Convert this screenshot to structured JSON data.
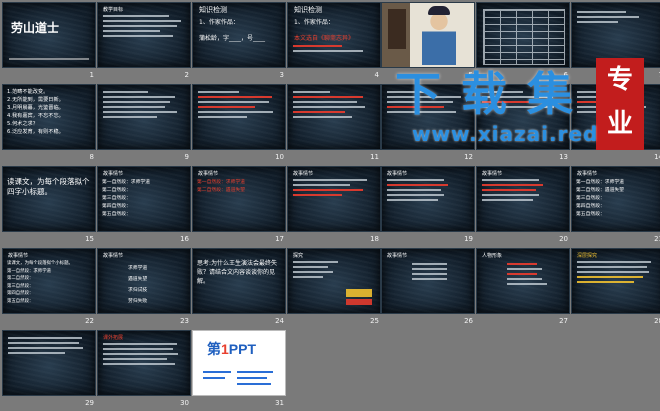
{
  "slides": [
    {
      "num": "1",
      "title": "劳山道士"
    },
    {
      "num": "2",
      "heading": "教学目标"
    },
    {
      "num": "3",
      "heading": "知识检测",
      "line1": "1、作家作品：",
      "line2": "蒲松龄，字____，号____"
    },
    {
      "num": "4",
      "heading": "知识检测",
      "line1": "1、作家作品：",
      "line2": "本文选自《聊斋志异》"
    },
    {
      "num": "5"
    },
    {
      "num": "6"
    },
    {
      "num": "7"
    },
    {
      "num": "8",
      "lines": [
        "1.范畴不能改变。",
        "2.无所能到，需要日新。",
        "3.月明晨暮，光鉴晋临。",
        "4.我有嘉宾，不忘不忘。",
        "5.何术之求？",
        "6.泛应发育，有则不稳。"
      ]
    },
    {
      "num": "9"
    },
    {
      "num": "10"
    },
    {
      "num": "11"
    },
    {
      "num": "12"
    },
    {
      "num": "13"
    },
    {
      "num": "14"
    },
    {
      "num": "15",
      "text": "读课文，为每个段落拟个四字小标题。"
    },
    {
      "num": "16",
      "heading": "故事情节",
      "lines": [
        "第一自然段：求师学道",
        "第二自然段：",
        "第三自然段：",
        "第四自然段：",
        "第五自然段："
      ]
    },
    {
      "num": "17",
      "heading": "故事情节",
      "lines": [
        "第一自然段：求师学道",
        "第二自然段：遇道失望"
      ]
    },
    {
      "num": "18",
      "heading": "故事情节"
    },
    {
      "num": "19",
      "heading": "故事情节"
    },
    {
      "num": "20",
      "heading": "故事情节"
    },
    {
      "num": "21",
      "heading": "故事情节",
      "lines": [
        "第一自然段：求师学道",
        "第二自然段：遇道失望",
        "第三自然段：",
        "第四自然段：",
        "第五自然段："
      ]
    },
    {
      "num": "22",
      "heading": "故事情节",
      "lines": [
        "读课文，为每个段落拟个小标题。",
        "第一自然段：求师学道",
        "第二自然段：",
        "第三自然段：",
        "第四自然段：",
        "第五自然段："
      ]
    },
    {
      "num": "23",
      "heading": "故事情节",
      "items": [
        "求师学道",
        "遇道失望",
        "求归试技",
        "劳归失败"
      ]
    },
    {
      "num": "24",
      "text": "思考:为什么王生演法会最终失败？请结合文内容谈谈你的见解。"
    },
    {
      "num": "25",
      "heading": "探究"
    },
    {
      "num": "26",
      "heading": "故事情节"
    },
    {
      "num": "27",
      "heading": "人物形象"
    },
    {
      "num": "28",
      "heading": "深层探究"
    },
    {
      "num": "29"
    },
    {
      "num": "30",
      "heading": "课外拓展"
    },
    {
      "num": "31",
      "logo_a": "第",
      "logo_b": "1",
      "logo_c": "PPT"
    }
  ],
  "watermark": {
    "chars": "下载集",
    "seal": [
      "专",
      "业"
    ],
    "url": "www.xiazai.red"
  }
}
